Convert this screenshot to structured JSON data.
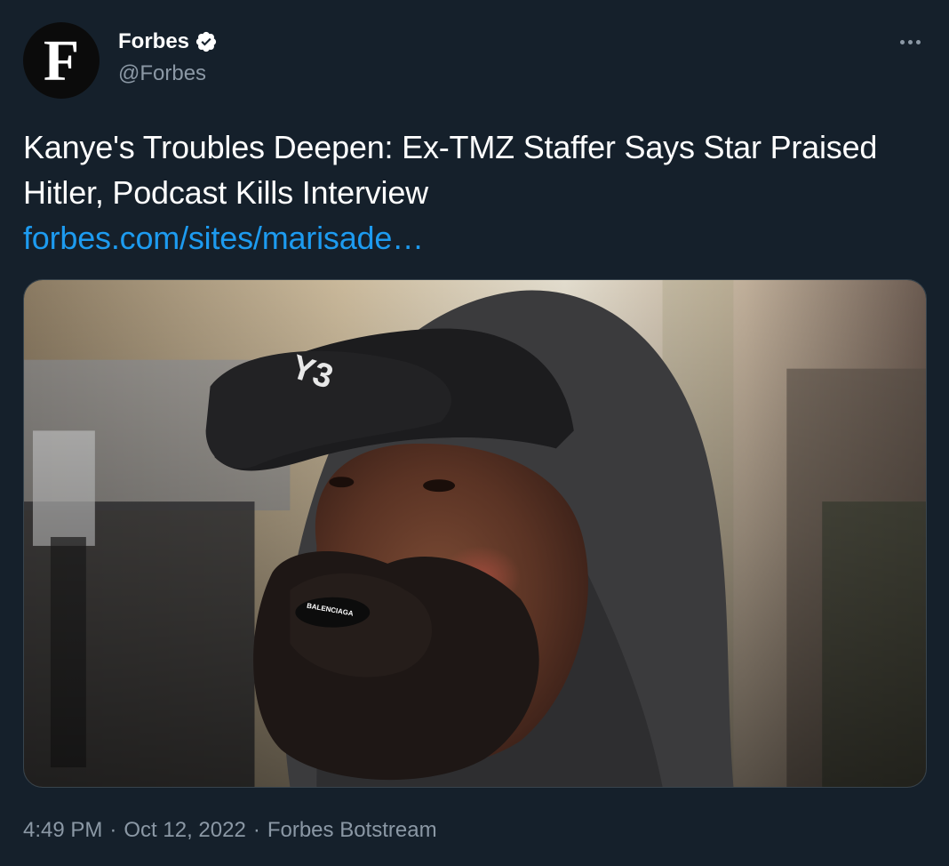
{
  "author": {
    "avatar_letter": "F",
    "display_name": "Forbes",
    "handle": "@Forbes",
    "verified": true,
    "verified_color": "#ffffff"
  },
  "menu": {
    "icon": "more-icon"
  },
  "tweet": {
    "text": "Kanye's Troubles Deepen: Ex-TMZ Staffer Says Star Praised Hitler, Podcast Kills Interview",
    "link_text": "forbes.com/sites/marisade…"
  },
  "media": {
    "cap_text": "Y3",
    "mouthguard_text": "BALENCIAGA"
  },
  "meta": {
    "time": "4:49 PM",
    "separator": "·",
    "date": "Oct 12, 2022",
    "source": "Forbes Botstream"
  },
  "colors": {
    "background": "#15202b",
    "link": "#1d9bf0",
    "secondary_text": "#8b98a5"
  }
}
